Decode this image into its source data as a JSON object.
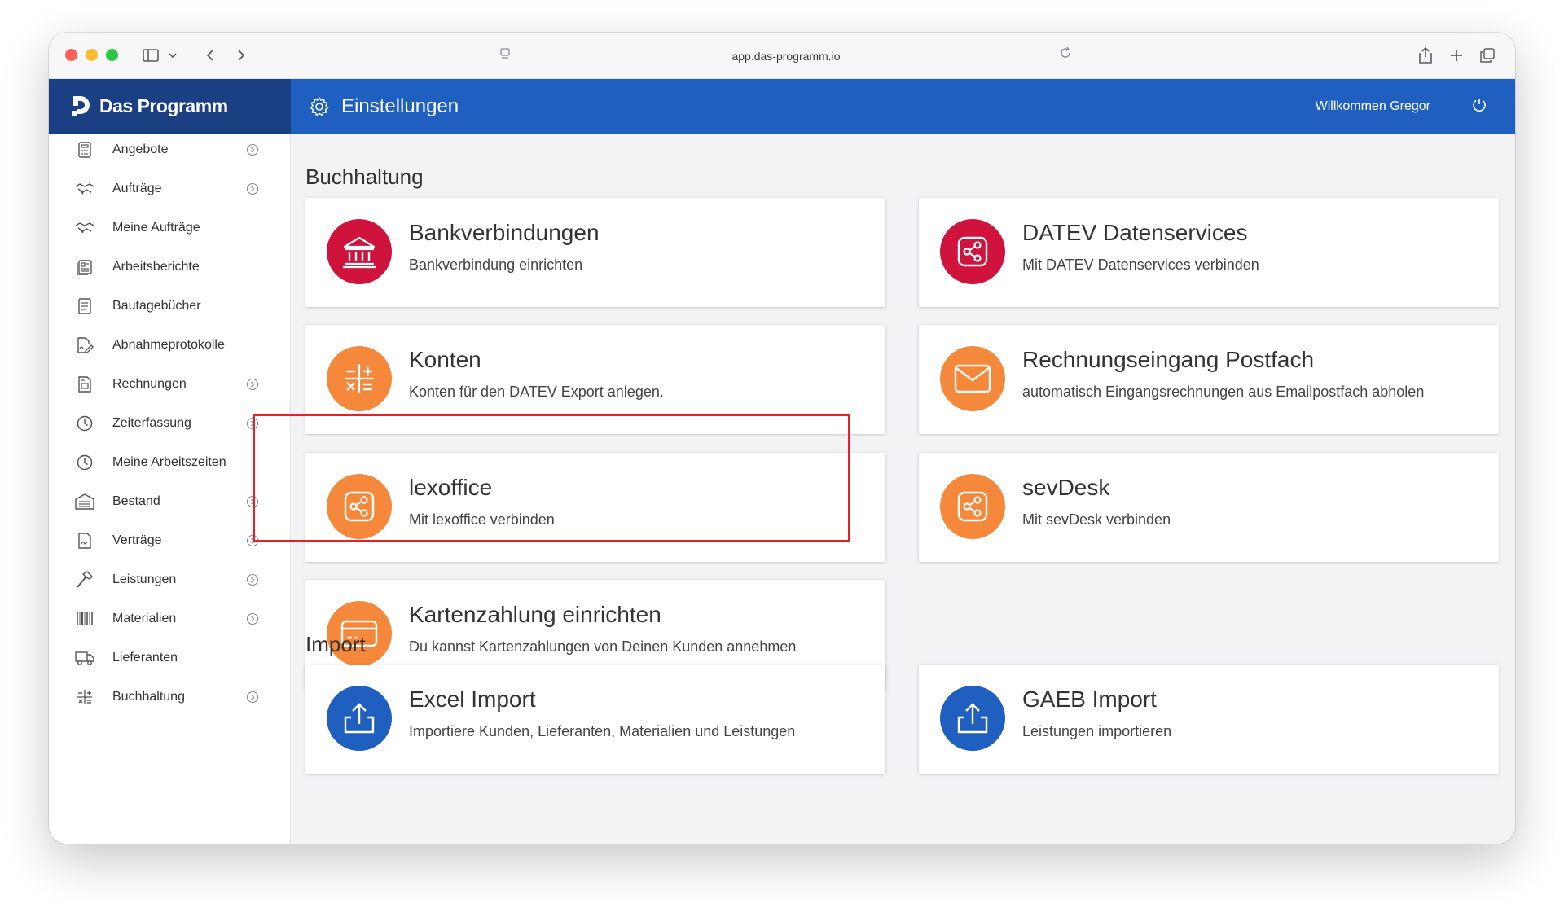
{
  "browser": {
    "url": "app.das-programm.io"
  },
  "app": {
    "logo": "Das Programm",
    "page_title": "Einstellungen",
    "welcome": "Willkommen Gregor"
  },
  "sidebar": {
    "items": [
      {
        "label": "Angebote",
        "icon": "calculator-icon",
        "expandable": true
      },
      {
        "label": "Aufträge",
        "icon": "handshake-icon",
        "expandable": true
      },
      {
        "label": "Meine Aufträge",
        "icon": "handshake-icon",
        "expandable": false
      },
      {
        "label": "Arbeitsberichte",
        "icon": "report-icon",
        "expandable": false
      },
      {
        "label": "Bautagebücher",
        "icon": "notebook-icon",
        "expandable": false
      },
      {
        "label": "Abnahmeprotokolle",
        "icon": "signed-document-icon",
        "expandable": false
      },
      {
        "label": "Rechnungen",
        "icon": "invoice-icon",
        "expandable": true
      },
      {
        "label": "Zeiterfassung",
        "icon": "clock-icon",
        "expandable": true
      },
      {
        "label": "Meine Arbeitszeiten",
        "icon": "clock-icon",
        "expandable": false
      },
      {
        "label": "Bestand",
        "icon": "warehouse-icon",
        "expandable": true
      },
      {
        "label": "Verträge",
        "icon": "contract-icon",
        "expandable": true
      },
      {
        "label": "Leistungen",
        "icon": "hammer-icon",
        "expandable": true
      },
      {
        "label": "Materialien",
        "icon": "barcode-icon",
        "expandable": true
      },
      {
        "label": "Lieferanten",
        "icon": "truck-icon",
        "expandable": false
      },
      {
        "label": "Buchhaltung",
        "icon": "sliders-icon",
        "expandable": true
      }
    ]
  },
  "sections": {
    "buchhaltung": "Buchhaltung",
    "import": "Import"
  },
  "cards": {
    "bank": {
      "title": "Bankverbindungen",
      "subtitle": "Bankverbindung einrichten",
      "icon": "bank-icon"
    },
    "datev": {
      "title": "DATEV Datenservices",
      "subtitle": "Mit DATEV Datenservices verbinden",
      "icon": "share-icon"
    },
    "konten": {
      "title": "Konten",
      "subtitle": "Konten für den DATEV Export anlegen.",
      "icon": "calculator-icon"
    },
    "postfach": {
      "title": "Rechnungseingang Postfach",
      "subtitle": "automatisch Eingangsrechnungen aus Emailpostfach abholen",
      "icon": "envelope-icon"
    },
    "lexoffice": {
      "title": "lexoffice",
      "subtitle": "Mit lexoffice verbinden",
      "icon": "share-icon"
    },
    "sevdesk": {
      "title": "sevDesk",
      "subtitle": "Mit sevDesk verbinden",
      "icon": "share-icon"
    },
    "karte": {
      "title": "Kartenzahlung einrichten",
      "subtitle": "Du kannst Kartenzahlungen von Deinen Kunden annehmen",
      "icon": "credit-card-icon"
    },
    "excel": {
      "title": "Excel Import",
      "subtitle": "Importiere Kunden, Lieferanten, Materialien und Leistungen",
      "icon": "upload-icon"
    },
    "gaeb": {
      "title": "GAEB Import",
      "subtitle": "Leistungen importieren",
      "icon": "upload-icon"
    }
  },
  "colors": {
    "header_blue": "#1e5fbf",
    "sidebar_header": "#1a3f82",
    "red": "#d0133d",
    "orange": "#f5883a",
    "import_blue": "#1e5fbf",
    "highlight": "#e8202a"
  }
}
